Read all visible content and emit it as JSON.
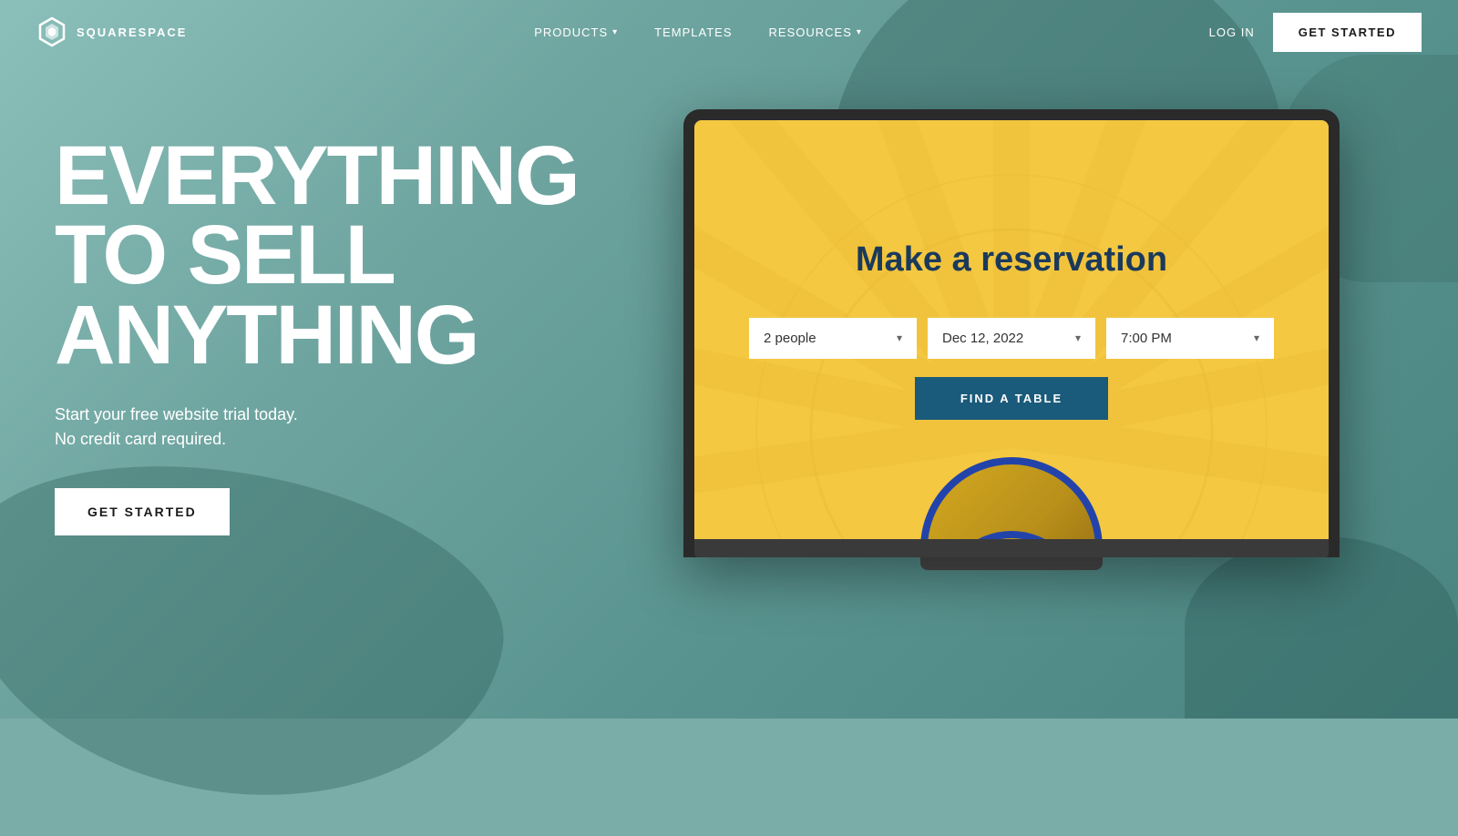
{
  "brand": {
    "name": "SQUARESPACE",
    "logo_alt": "Squarespace logo"
  },
  "nav": {
    "products_label": "PRODUCTS",
    "templates_label": "TEMPLATES",
    "resources_label": "RESOURCES",
    "login_label": "LOG IN",
    "cta_label": "GET STARTED"
  },
  "hero": {
    "title_line1": "EVERYTHING",
    "title_line2": "TO SELL",
    "title_line3": "ANYTHING",
    "subtitle_line1": "Start your free website trial today.",
    "subtitle_line2": "No credit card required.",
    "cta_label": "GET STARTED"
  },
  "laptop_screen": {
    "reservation_title": "Make a reservation",
    "people_value": "2 people",
    "date_value": "Dec 12, 2022",
    "time_value": "7:00 PM",
    "find_table_label": "FIND A TABLE"
  },
  "colors": {
    "bg_teal": "#7aada8",
    "navy": "#1a3a5c",
    "button_navy": "#1a5a7a",
    "screen_yellow": "#f0c040",
    "white": "#ffffff"
  }
}
